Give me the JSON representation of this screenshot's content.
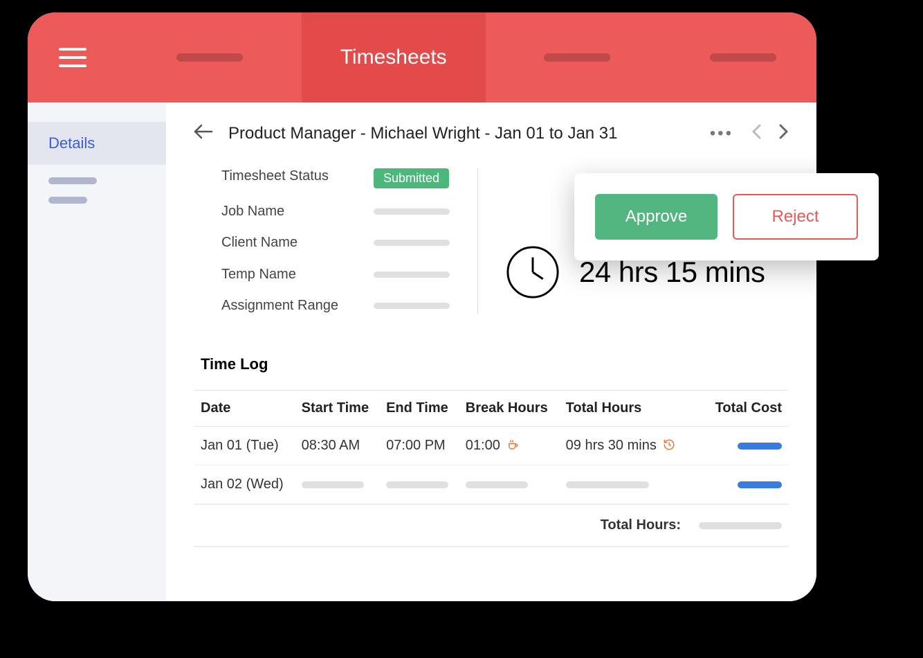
{
  "header": {
    "active_tab_label": "Timesheets"
  },
  "sidebar": {
    "items": [
      {
        "label": "Details",
        "active": true
      }
    ]
  },
  "breadcrumb": {
    "title": "Product Manager - Michael Wright  - Jan 01 to Jan 31"
  },
  "status": {
    "labels": {
      "status": "Timesheet Status",
      "job": "Job Name",
      "client": "Client Name",
      "temp": "Temp Name",
      "range": "Assignment Range"
    },
    "status_value": "Submitted"
  },
  "total_time": "24 hrs 15 mins",
  "actions": {
    "approve": "Approve",
    "reject": "Reject"
  },
  "timelog": {
    "title": "Time Log",
    "headers": {
      "date": "Date",
      "start": "Start Time",
      "end": "End Time",
      "break": "Break Hours",
      "total": "Total Hours",
      "cost": "Total Cost"
    },
    "rows": [
      {
        "date": "Jan 01 (Tue)",
        "start": "08:30 AM",
        "end": "07:00 PM",
        "break": "01:00",
        "total": "09 hrs 30 mins"
      },
      {
        "date": "Jan 02 (Wed)"
      }
    ],
    "footer_label": "Total Hours:"
  }
}
